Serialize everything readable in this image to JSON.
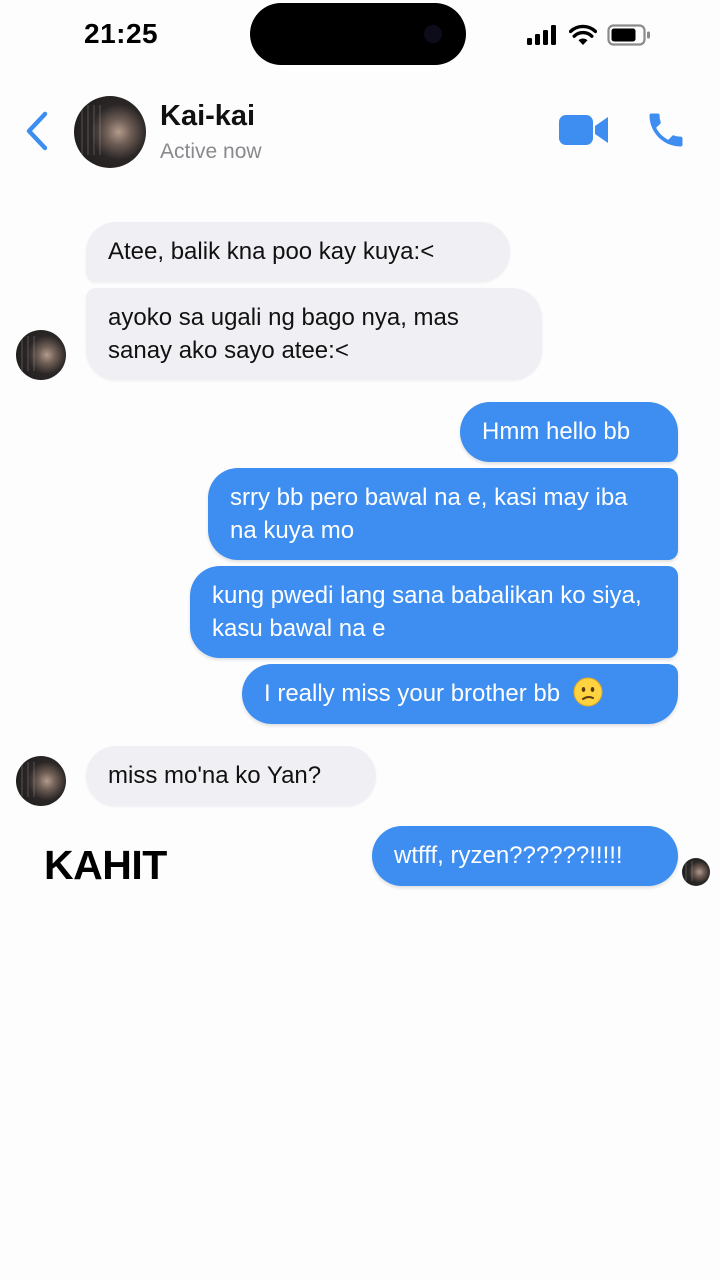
{
  "status_bar": {
    "time": "21:25"
  },
  "header": {
    "contact_name": "Kai-kai",
    "contact_status": "Active now",
    "back_icon": "chevron-left-icon",
    "video_icon": "video-camera-icon",
    "call_icon": "phone-icon"
  },
  "messages": [
    {
      "sender": "contact",
      "text": "Atee, balik kna poo kay kuya:<"
    },
    {
      "sender": "contact",
      "text": "ayoko sa ugali ng bago nya, mas sanay ako sayo atee:<"
    },
    {
      "sender": "me",
      "text": "Hmm hello bb"
    },
    {
      "sender": "me",
      "text": "srry bb pero bawal na e, kasi may iba na kuya mo"
    },
    {
      "sender": "me",
      "text": "kung pwedi lang sana babalikan ko siya, kasu bawal na e"
    },
    {
      "sender": "me",
      "text": "I really miss your brother bb",
      "emoji": "confused-face"
    },
    {
      "sender": "contact",
      "text": "miss mo'na ko Yan?"
    },
    {
      "sender": "me",
      "text": "wtfff, ryzen??????!!!!!"
    }
  ],
  "overlay_caption": "KAHIT",
  "colors": {
    "accent": "#3d8ef0",
    "incoming_bubble": "#f0f0f4",
    "secondary_text": "#8a8a8e"
  }
}
